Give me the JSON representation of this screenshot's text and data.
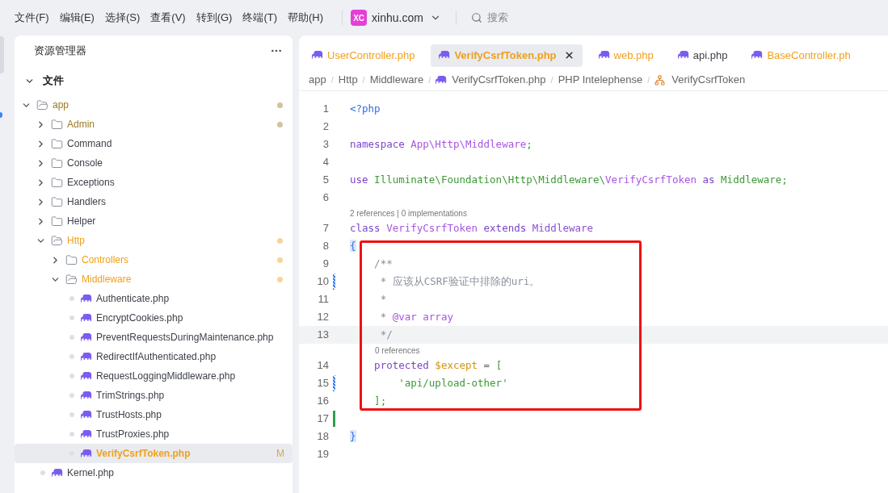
{
  "menu": [
    "文件(F)",
    "编辑(E)",
    "选择(S)",
    "查看(V)",
    "转到(G)",
    "终端(T)",
    "帮助(H)"
  ],
  "workspace": {
    "logo": "XC",
    "name": "xinhu.com"
  },
  "search": {
    "placeholder": "搜索"
  },
  "explorer": {
    "title": "资源管理器",
    "section": {
      "label": "文件",
      "expanded": true
    },
    "tree": [
      {
        "name": "app",
        "kind": "folder",
        "expanded": true,
        "color": "#9a7a22",
        "dot": true,
        "selected": false,
        "children": [
          {
            "name": "Admin",
            "kind": "folder",
            "expanded": false,
            "color": "#9a7a22",
            "dot": true,
            "selected": false
          },
          {
            "name": "Command",
            "kind": "folder",
            "expanded": false,
            "color": "#3b3f47",
            "dot": false,
            "selected": false
          },
          {
            "name": "Console",
            "kind": "folder",
            "expanded": false,
            "color": "#3b3f47",
            "dot": false,
            "selected": false
          },
          {
            "name": "Exceptions",
            "kind": "folder",
            "expanded": false,
            "color": "#3b3f47",
            "dot": false,
            "selected": false
          },
          {
            "name": "Handlers",
            "kind": "folder",
            "expanded": false,
            "color": "#3b3f47",
            "dot": false,
            "selected": false
          },
          {
            "name": "Helper",
            "kind": "folder",
            "expanded": false,
            "color": "#3b3f47",
            "dot": false,
            "selected": false
          },
          {
            "name": "Http",
            "kind": "folder",
            "expanded": true,
            "color": "#f0a01c",
            "dot": true,
            "selected": false,
            "children": [
              {
                "name": "Controllers",
                "kind": "folder",
                "expanded": false,
                "color": "#f0a01c",
                "dot": true,
                "selected": false
              },
              {
                "name": "Middleware",
                "kind": "folder",
                "expanded": true,
                "color": "#f0a01c",
                "dot": true,
                "selected": false,
                "children": [
                  {
                    "name": "Authenticate.php",
                    "kind": "php",
                    "color": "#3b3f47",
                    "dot": false,
                    "selected": false
                  },
                  {
                    "name": "EncryptCookies.php",
                    "kind": "php",
                    "color": "#3b3f47",
                    "dot": false,
                    "selected": false
                  },
                  {
                    "name": "PreventRequestsDuringMaintenance.php",
                    "kind": "php",
                    "color": "#3b3f47",
                    "dot": false,
                    "selected": false
                  },
                  {
                    "name": "RedirectIfAuthenticated.php",
                    "kind": "php",
                    "color": "#3b3f47",
                    "dot": false,
                    "selected": false
                  },
                  {
                    "name": "RequestLoggingMiddleware.php",
                    "kind": "php",
                    "color": "#3b3f47",
                    "dot": false,
                    "selected": false
                  },
                  {
                    "name": "TrimStrings.php",
                    "kind": "php",
                    "color": "#3b3f47",
                    "dot": false,
                    "selected": false
                  },
                  {
                    "name": "TrustHosts.php",
                    "kind": "php",
                    "color": "#3b3f47",
                    "dot": false,
                    "selected": false
                  },
                  {
                    "name": "TrustProxies.php",
                    "kind": "php",
                    "color": "#3b3f47",
                    "dot": false,
                    "selected": false
                  },
                  {
                    "name": "VerifyCsrfToken.php",
                    "kind": "php",
                    "color": "#f0a01c",
                    "dot": false,
                    "badge": "M",
                    "selected": true
                  }
                ]
              }
            ]
          },
          {
            "name": "Kernel.php",
            "kind": "php",
            "color": "#3b3f47",
            "dot": false,
            "selected": false
          }
        ]
      }
    ]
  },
  "tabs": [
    {
      "label": "UserController.php",
      "color": "#f0a01c",
      "selected": false
    },
    {
      "label": "VerifyCsrfToken.php",
      "color": "#f0a01c",
      "selected": true
    },
    {
      "label": "web.php",
      "color": "#f0a01c",
      "selected": false
    },
    {
      "label": "api.php",
      "color": "#3b3f47",
      "selected": false
    },
    {
      "label": "BaseController.ph",
      "color": "#f0a01c",
      "selected": false
    }
  ],
  "breadcrumb": {
    "separator": "/",
    "items": [
      {
        "label": "app",
        "kind": "text"
      },
      {
        "label": "Http",
        "kind": "text"
      },
      {
        "label": "Middleware",
        "kind": "text"
      },
      {
        "label": "VerifyCsrfToken.php",
        "kind": "php"
      },
      {
        "label": "PHP Intelephense",
        "kind": "text"
      },
      {
        "label": "VerifyCsrfToken",
        "kind": "class"
      }
    ]
  },
  "code": [
    {
      "n": "1",
      "modified": false,
      "added": false,
      "current": false,
      "tokens": [
        {
          "kind": "tag",
          "text": "<?php"
        }
      ]
    },
    {
      "n": "2",
      "modified": false,
      "added": false,
      "current": false
    },
    {
      "n": "3",
      "modified": false,
      "added": false,
      "current": false,
      "tokens": [
        {
          "kind": "keyword",
          "text": "namespace "
        },
        {
          "kind": "name",
          "text": "App\\Http\\Middleware"
        },
        {
          "kind": "path",
          "text": ";"
        }
      ]
    },
    {
      "n": "4",
      "modified": false,
      "added": false,
      "current": false
    },
    {
      "n": "5",
      "modified": false,
      "added": false,
      "current": false,
      "tokens": [
        {
          "kind": "keyword",
          "text": "use "
        },
        {
          "kind": "path",
          "text": "Illuminate\\Foundation\\Http\\Middleware\\"
        },
        {
          "kind": "name",
          "text": "VerifyCsrfToken"
        },
        {
          "kind": "keyword",
          "text": " as "
        },
        {
          "kind": "path",
          "text": "Middleware;"
        }
      ]
    },
    {
      "n": "6",
      "modified": false,
      "added": false,
      "current": false
    },
    {
      "n": "7",
      "modified": false,
      "added": false,
      "current": false,
      "lens": "2 references | 0 implementations",
      "lens_indented": false,
      "tokens": [
        {
          "kind": "keyword",
          "text": "class "
        },
        {
          "kind": "name",
          "text": "VerifyCsrfToken"
        },
        {
          "kind": "keyword",
          "text": " extends "
        },
        {
          "kind": "type",
          "text": "Middleware"
        }
      ]
    },
    {
      "n": "8",
      "modified": false,
      "added": false,
      "current": false,
      "tokens": [
        {
          "kind": "brace",
          "text": "{"
        }
      ]
    },
    {
      "n": "9",
      "modified": false,
      "added": false,
      "current": false,
      "tokens": [
        {
          "kind": "comment",
          "text": "    /**"
        }
      ]
    },
    {
      "n": "10",
      "modified": true,
      "added": false,
      "current": false,
      "tokens": [
        {
          "kind": "comment",
          "text": "     * 应该从CSRF验证中排除的uri。"
        }
      ]
    },
    {
      "n": "11",
      "modified": false,
      "added": false,
      "current": false,
      "tokens": [
        {
          "kind": "comment",
          "text": "     *"
        }
      ]
    },
    {
      "n": "12",
      "modified": false,
      "added": false,
      "current": false,
      "tokens": [
        {
          "kind": "comment",
          "text": "     * "
        },
        {
          "kind": "name",
          "text": "@var array"
        }
      ]
    },
    {
      "n": "13",
      "modified": false,
      "added": false,
      "current": true,
      "tokens": [
        {
          "kind": "comment",
          "text": "     */"
        }
      ]
    },
    {
      "n": "14",
      "modified": false,
      "added": false,
      "current": false,
      "lens": "0 references",
      "lens_indented": true,
      "tokens": [
        {
          "kind": "keyword",
          "text": "    protected "
        },
        {
          "kind": "variable",
          "text": "$except"
        },
        {
          "kind": "operator",
          "text": " = "
        },
        {
          "kind": "path",
          "text": "["
        }
      ]
    },
    {
      "n": "15",
      "modified": true,
      "added": false,
      "current": false,
      "tokens": [
        {
          "kind": "string",
          "text": "        'api/upload-other'"
        }
      ]
    },
    {
      "n": "16",
      "modified": false,
      "added": false,
      "current": false,
      "tokens": [
        {
          "kind": "path",
          "text": "    ];"
        }
      ]
    },
    {
      "n": "17",
      "modified": false,
      "added": true,
      "current": false
    },
    {
      "n": "18",
      "modified": false,
      "added": false,
      "current": false,
      "tokens": [
        {
          "kind": "brace",
          "text": "}"
        }
      ]
    },
    {
      "n": "19",
      "modified": false,
      "added": false,
      "current": false
    }
  ]
}
